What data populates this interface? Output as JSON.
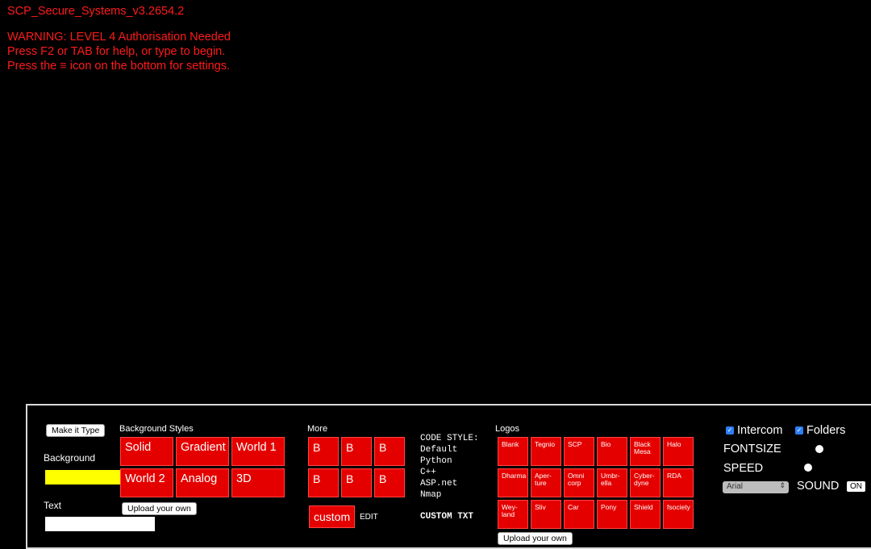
{
  "terminal": {
    "title": "SCP_Secure_Systems_v3.2654.2",
    "warning": "WARNING: LEVEL 4 Authorisation Needed",
    "help": "Press F2 or TAB for help, or type to begin.",
    "settings_prefix": "Press the ",
    "settings_icon": "≡",
    "settings_suffix": " icon on the bottom for settings."
  },
  "settings": {
    "make_it_type": "Make it Type",
    "background_label": "Background",
    "background_color": "#ffff00",
    "text_label": "Text",
    "text_color": "#ffffff",
    "background_styles": {
      "heading": "Background Styles",
      "buttons": [
        "Solid",
        "Gradient",
        "World 1",
        "World 2",
        "Analog",
        "3D"
      ],
      "upload": "Upload your own"
    },
    "more": {
      "heading": "More",
      "buttons": [
        "B",
        "B",
        "B",
        "B",
        "B",
        "B"
      ],
      "custom": "custom",
      "edit": "EDIT"
    },
    "code_style": {
      "heading": "CODE STYLE:",
      "options": [
        "Default",
        "Python",
        "C++",
        "ASP.net",
        "Nmap"
      ],
      "custom_txt": "CUSTOM TXT"
    },
    "logos": {
      "heading": "Logos",
      "buttons": [
        [
          "Blank"
        ],
        [
          "Tegnio"
        ],
        [
          "SCP"
        ],
        [
          "Bio"
        ],
        [
          "Black",
          "Mesa"
        ],
        [
          "Halo"
        ],
        [
          "Dharma"
        ],
        [
          "Aper-",
          "ture"
        ],
        [
          "Omni",
          "corp"
        ],
        [
          "Umbr-",
          "ella"
        ],
        [
          "Cyber-",
          "dyne"
        ],
        [
          "RDA"
        ],
        [
          "Wey-",
          "land"
        ],
        [
          "Sliv"
        ],
        [
          "Car"
        ],
        [
          "Pony"
        ],
        [
          "Shield"
        ],
        [
          "fsociety"
        ]
      ],
      "upload": "Upload your own"
    },
    "right": {
      "intercom": "Intercom",
      "folders": "Folders",
      "fontsize": "FONTSIZE",
      "speed": "SPEED",
      "font_select": "Arial",
      "sound": "SOUND",
      "sound_toggle": "ON"
    }
  }
}
